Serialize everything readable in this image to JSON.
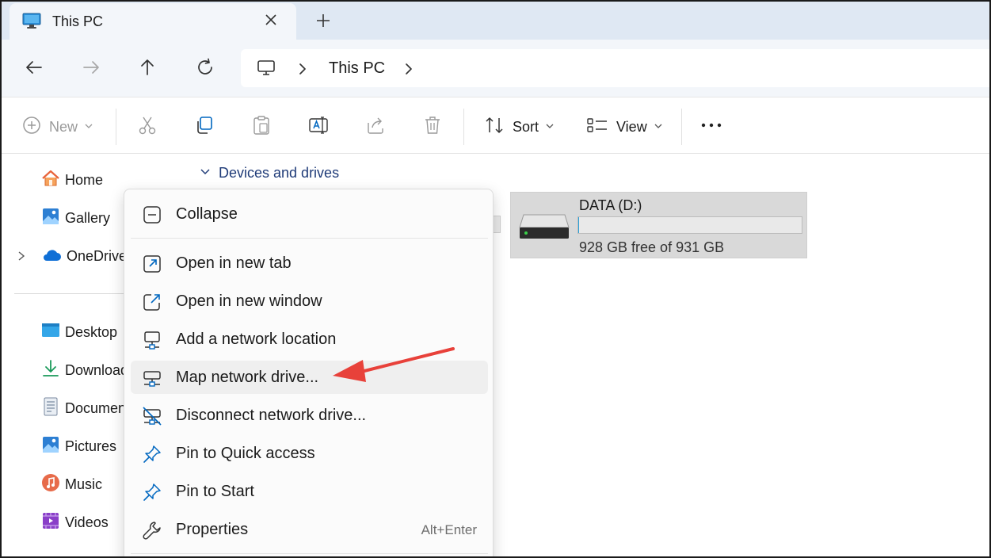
{
  "window": {
    "tab_title": "This PC"
  },
  "address": {
    "crumb": "This PC"
  },
  "toolbar": {
    "new_label": "New",
    "sort_label": "Sort",
    "view_label": "View"
  },
  "sidebar": {
    "items": [
      {
        "label": "Home"
      },
      {
        "label": "Gallery"
      },
      {
        "label": "OneDrive"
      },
      {
        "label": "Desktop"
      },
      {
        "label": "Downloads"
      },
      {
        "label": "Documents"
      },
      {
        "label": "Pictures"
      },
      {
        "label": "Music"
      },
      {
        "label": "Videos"
      }
    ]
  },
  "main": {
    "section_title": "Devices and drives",
    "drive": {
      "name": "DATA (D:)",
      "free_text": "928 GB free of 931 GB",
      "used_fraction": 0.003
    }
  },
  "context_menu": {
    "items": [
      {
        "label": "Collapse"
      },
      {
        "label": "Open in new tab"
      },
      {
        "label": "Open in new window"
      },
      {
        "label": "Add a network location"
      },
      {
        "label": "Map network drive..."
      },
      {
        "label": "Disconnect network drive..."
      },
      {
        "label": "Pin to Quick access"
      },
      {
        "label": "Pin to Start"
      },
      {
        "label": "Properties",
        "shortcut": "Alt+Enter"
      }
    ]
  },
  "colors": {
    "accent": "#0067c0",
    "annotation_arrow": "#e8413a",
    "tabbar_bg": "#dfe8f3"
  }
}
